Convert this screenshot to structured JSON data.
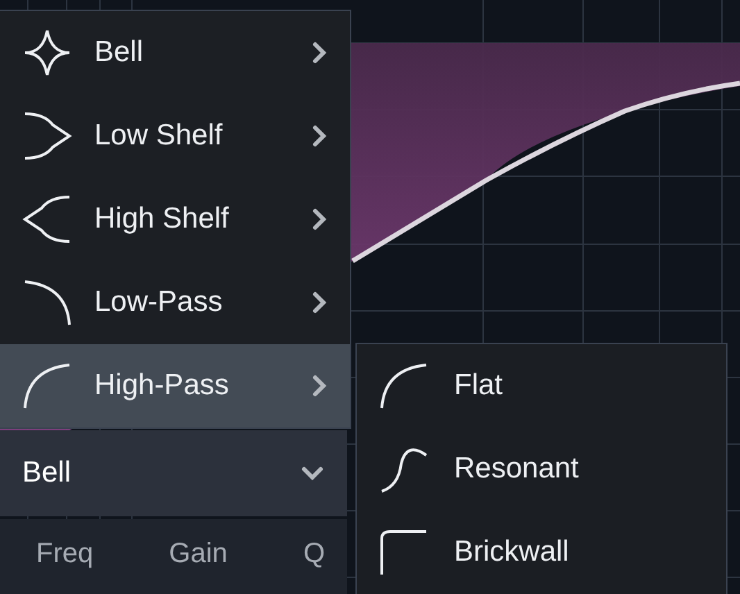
{
  "filter_menu": {
    "items": [
      {
        "kind": "bell",
        "label": "Bell",
        "selected": false
      },
      {
        "kind": "low-shelf",
        "label": "Low Shelf",
        "selected": false
      },
      {
        "kind": "high-shelf",
        "label": "High Shelf",
        "selected": false
      },
      {
        "kind": "low-pass",
        "label": "Low-Pass",
        "selected": false
      },
      {
        "kind": "high-pass",
        "label": "High-Pass",
        "selected": true
      }
    ]
  },
  "submenu": {
    "items": [
      {
        "kind": "flat",
        "label": "Flat"
      },
      {
        "kind": "resonant",
        "label": "Resonant"
      },
      {
        "kind": "brickwall",
        "label": "Brickwall"
      }
    ]
  },
  "filter_select": {
    "value": "Bell"
  },
  "params": {
    "labels": [
      "Freq",
      "Gain",
      "Q"
    ]
  }
}
